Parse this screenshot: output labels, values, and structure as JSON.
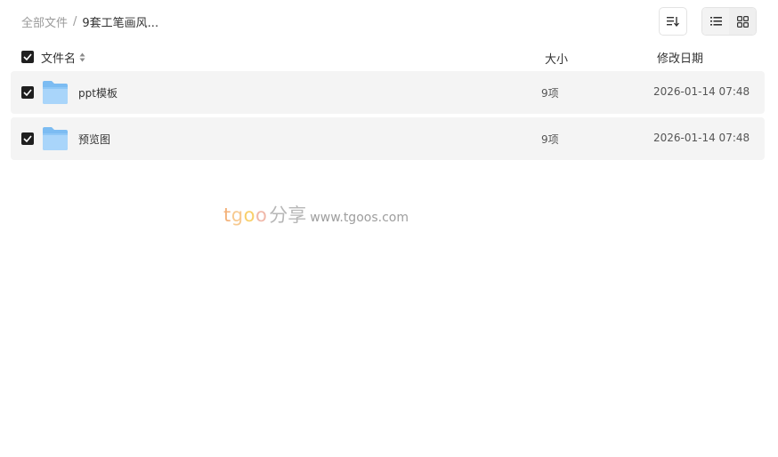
{
  "breadcrumb": {
    "root": "全部文件",
    "separator": "/",
    "current": "9套工笔画风..."
  },
  "toolbar": {
    "sort_icon": "sort-icon",
    "list_view_icon": "list-view-icon",
    "grid_view_icon": "grid-view-icon"
  },
  "table": {
    "columns": {
      "name": "文件名",
      "size": "大小",
      "date": "修改日期"
    },
    "rows": [
      {
        "name": "ppt模板",
        "size": "9项",
        "date": "2026-01-14 07:48",
        "checked": true,
        "icon": "folder-icon"
      },
      {
        "name": "预览图",
        "size": "9项",
        "date": "2026-01-14 07:48",
        "checked": true,
        "icon": "folder-icon"
      }
    ]
  },
  "watermark": {
    "brand": "tgoo",
    "brand_t": "t",
    "brand_g": "g",
    "brand_o1": "o",
    "brand_o2": "o",
    "share": "分享",
    "url": "www.tgoos.com"
  },
  "colors": {
    "row_bg": "#f4f4f4",
    "checkbox": "#1f1f1f",
    "folder": "#7cbcf2"
  }
}
